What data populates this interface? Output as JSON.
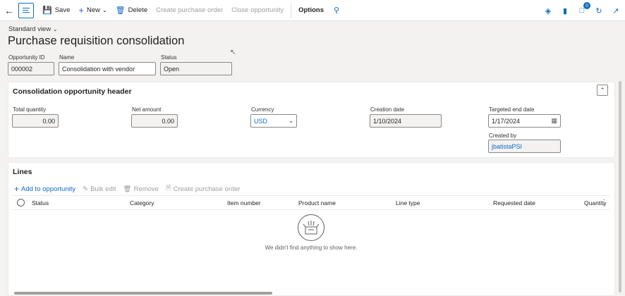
{
  "toolbar": {
    "save": "Save",
    "new": "New",
    "delete": "Delete",
    "create_po": "Create purchase order",
    "close_opportunity": "Close opportunity",
    "options": "Options",
    "notification_count": "0"
  },
  "header": {
    "view": "Standard view",
    "title": "Purchase requisition consolidation"
  },
  "summary": {
    "opportunity_id_label": "Opportunity ID",
    "opportunity_id": "000002",
    "name_label": "Name",
    "name": "Consolidation with vendor",
    "status_label": "Status",
    "status": "Open"
  },
  "opportunity_header": {
    "title": "Consolidation opportunity header",
    "total_quantity_label": "Total quantity",
    "total_quantity": "0.00",
    "net_amount_label": "Net amount",
    "net_amount": "0.00",
    "currency_label": "Currency",
    "currency": "USD",
    "creation_date_label": "Creation date",
    "creation_date": "1/10/2024",
    "targeted_end_date_label": "Targeted end date",
    "targeted_end_date": "1/17/2024",
    "created_by_label": "Created by",
    "created_by": "jbatistaPSI"
  },
  "lines": {
    "title": "Lines",
    "actions": {
      "add": "Add to opportunity",
      "bulk_edit": "Bulk edit",
      "remove": "Remove",
      "create_po": "Create purchase order"
    },
    "columns": [
      "Status",
      "Category",
      "Item number",
      "Product name",
      "Line type",
      "Requested date",
      "Quantity"
    ],
    "empty_message": "We didn't find anything to show here."
  },
  "colors": {
    "accent": "#0f6cbd",
    "disabled": "#a19f9d"
  }
}
